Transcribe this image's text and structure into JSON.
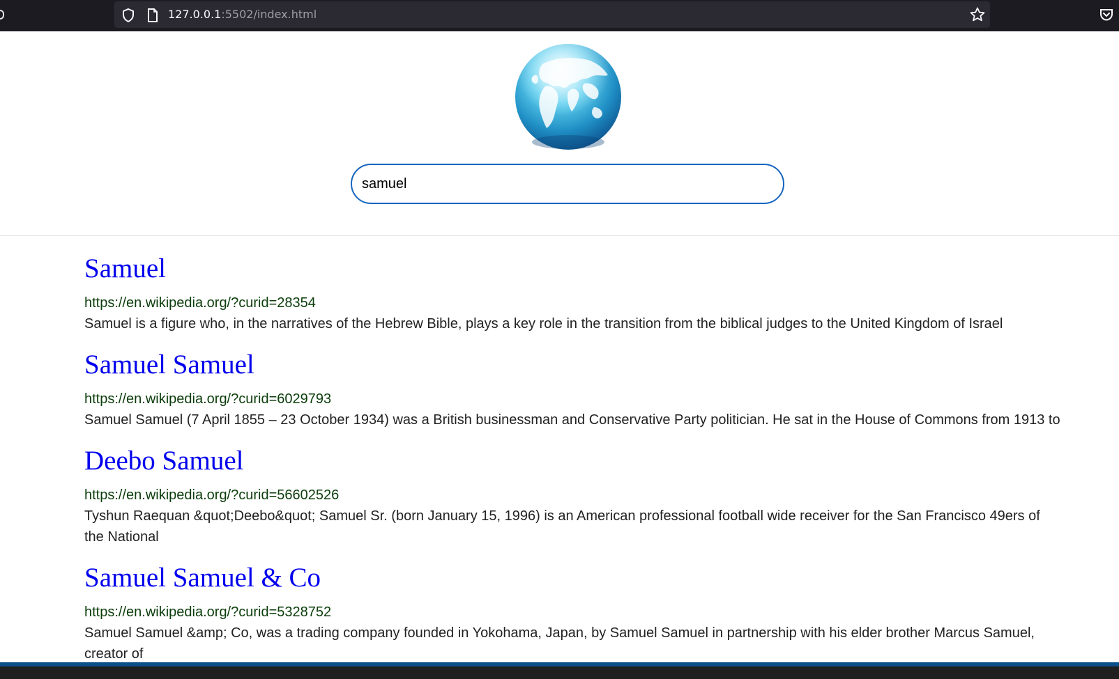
{
  "browser": {
    "url_host": "127.0.0.1",
    "url_rest": ":5502/index.html"
  },
  "search": {
    "value": "samuel"
  },
  "results": [
    {
      "title": "Samuel",
      "url": "https://en.wikipedia.org/?curid=28354",
      "snippet": "Samuel is a figure who, in the narratives of the Hebrew Bible, plays a key role in the transition from the biblical judges to the United Kingdom of Israel"
    },
    {
      "title": "Samuel Samuel",
      "url": "https://en.wikipedia.org/?curid=6029793",
      "snippet": "Samuel Samuel (7 April 1855 – 23 October 1934) was a British businessman and Conservative Party politician. He sat in the House of Commons from 1913 to"
    },
    {
      "title": "Deebo Samuel",
      "url": "https://en.wikipedia.org/?curid=56602526",
      "snippet": "Tyshun Raequan &quot;Deebo&quot; Samuel Sr. (born January 15, 1996) is an American professional football wide receiver for the San Francisco 49ers of the National"
    },
    {
      "title": "Samuel Samuel & Co",
      "url": "https://en.wikipedia.org/?curid=5328752",
      "snippet": "Samuel Samuel &amp; Co, was a trading company founded in Yokohama, Japan, by Samuel Samuel in partnership with his elder brother Marcus Samuel, creator of"
    }
  ],
  "colors": {
    "link": "#0000ee",
    "search_border": "#1565c0",
    "chrome_bg": "#1c1b22"
  }
}
